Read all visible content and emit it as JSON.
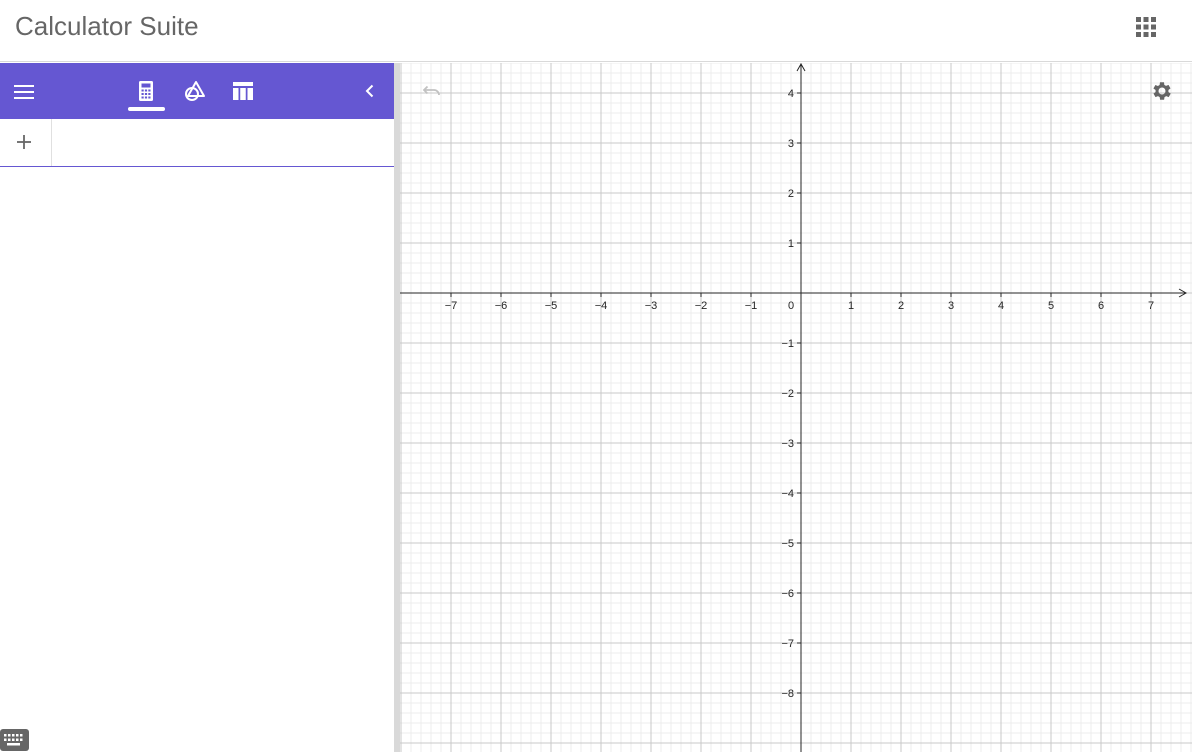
{
  "app": {
    "title": "Calculator Suite"
  },
  "header": {
    "apps_icon": "apps-grid-icon"
  },
  "toolbar": {
    "accent": "#6557d2",
    "menu_icon": "menu-icon",
    "tabs": [
      {
        "icon": "calculator-icon",
        "active": true
      },
      {
        "icon": "geometry-icon",
        "active": false
      },
      {
        "icon": "table-icon",
        "active": false
      }
    ],
    "collapse_icon": "chevron-left-icon"
  },
  "algebra": {
    "add_icon": "plus-icon",
    "input_value": "",
    "keyboard_icon": "keyboard-icon"
  },
  "graphics": {
    "undo_icon": "undo-icon",
    "settings_icon": "gear-icon",
    "x_ticks": [
      "−7",
      "−6",
      "−5",
      "−4",
      "−3",
      "−2",
      "−1",
      "1",
      "2",
      "3",
      "4",
      "5",
      "6",
      "7"
    ],
    "y_ticks": [
      "4",
      "3",
      "2",
      "1",
      "−1",
      "−2",
      "−3",
      "−4",
      "−5",
      "−6",
      "−7",
      "−8"
    ],
    "origin_label": "0",
    "x_range": [
      -8,
      8
    ],
    "y_range": [
      -9,
      4.5
    ],
    "grid": true,
    "minor_grid": true
  }
}
